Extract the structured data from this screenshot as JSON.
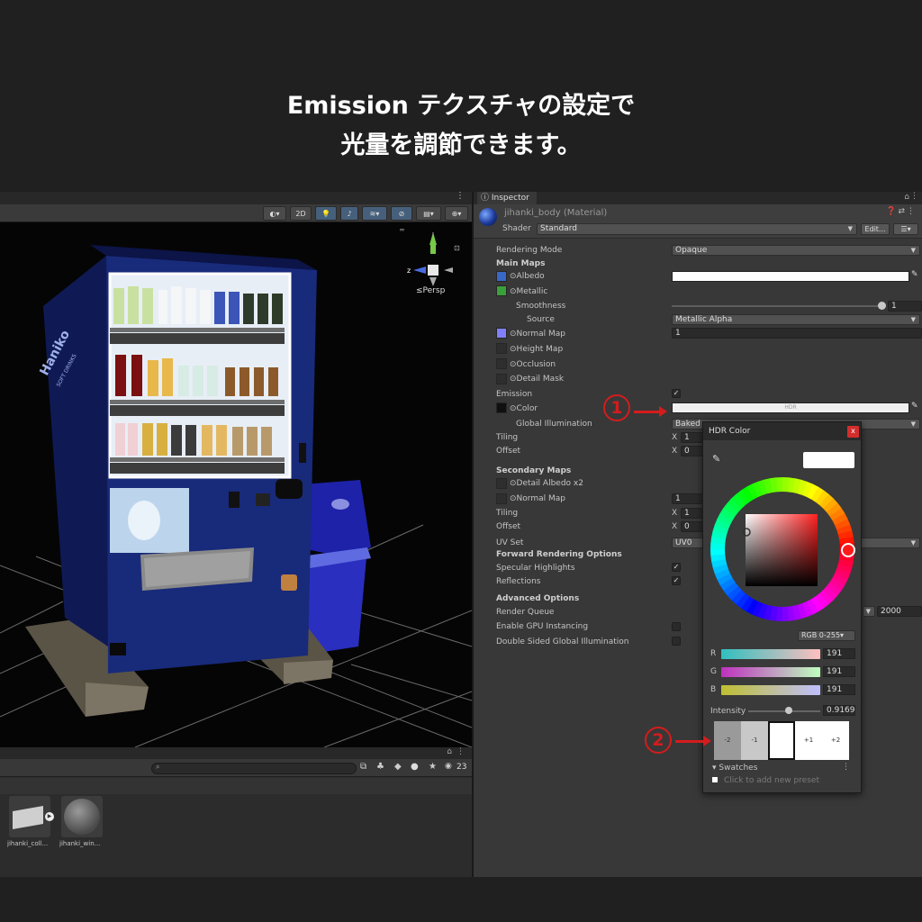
{
  "caption": {
    "line1": "Emission テクスチャの設定で",
    "line2": "光量を調節できます。"
  },
  "scene": {
    "toolbar": {
      "mode_2d": "2D"
    },
    "gizmo": {
      "z_axis": "z",
      "projection": "≤Persp"
    },
    "vending_machine": {
      "brand": "Haniko",
      "brand_sub": "SOFT DRINKS"
    }
  },
  "project": {
    "object_count": "23",
    "assets": [
      {
        "name": "jihanki_coll...",
        "icon": "prefab-icon"
      },
      {
        "name": "jihanki_win...",
        "icon": "material-icon"
      }
    ]
  },
  "inspector": {
    "tab_label": "Inspector",
    "material_title": "jihanki_body (Material)",
    "shader_label": "Shader",
    "shader_value": "Standard",
    "edit_label": "Edit...",
    "rendering_mode_label": "Rendering Mode",
    "rendering_mode_value": "Opaque",
    "main_maps_label": "Main Maps",
    "albedo_label": "Albedo",
    "metallic_label": "Metallic",
    "smoothness_label": "Smoothness",
    "smoothness_value": "1",
    "smoothness_fraction": 1.0,
    "source_label": "Source",
    "source_value": "Metallic Alpha",
    "normal_map_label": "Normal Map",
    "normal_map_value": "1",
    "height_map_label": "Height Map",
    "occlusion_label": "Occlusion",
    "detail_mask_label": "Detail Mask",
    "emission_label": "Emission",
    "emission_checked": true,
    "color_label": "Color",
    "color_hdr_text": "HDR",
    "global_illumination_label": "Global Illumination",
    "global_illumination_value": "Baked",
    "tiling_label": "Tiling",
    "tiling_x": "1",
    "offset_label": "Offset",
    "offset_x": "0",
    "secondary_maps_label": "Secondary Maps",
    "detail_albedo_label": "Detail Albedo x2",
    "secondary_normal_label": "Normal Map",
    "secondary_normal_value": "1",
    "sec_tiling_label": "Tiling",
    "sec_tiling_x": "1",
    "sec_offset_label": "Offset",
    "sec_offset_x": "0",
    "uv_set_label": "UV Set",
    "uv_set_value": "UV0",
    "forward_label": "Forward Rendering Options",
    "specular_label": "Specular Highlights",
    "reflections_label": "Reflections",
    "advanced_label": "Advanced Options",
    "render_queue_label": "Render Queue",
    "render_queue_value": "2000",
    "gpu_instancing_label": "Enable GPU Instancing",
    "double_sided_label": "Double Sided Global Illumination",
    "x_label": "X"
  },
  "annotations": {
    "one": "1",
    "two": "2"
  },
  "hdr_picker": {
    "title": "HDR Color",
    "close": "x",
    "mode": "RGB 0-255",
    "channels": [
      {
        "label": "R",
        "value": "191"
      },
      {
        "label": "G",
        "value": "191"
      },
      {
        "label": "B",
        "value": "191"
      }
    ],
    "intensity_label": "Intensity",
    "intensity_value": "0.9169",
    "exposure_stops": [
      "-2",
      "-1",
      "",
      "+1",
      "+2"
    ],
    "swatches_label": "Swatches",
    "preset_hint": "Click to add new preset",
    "colors": {
      "accent_red": "#d41c1c",
      "preview": "#ffffff"
    }
  }
}
